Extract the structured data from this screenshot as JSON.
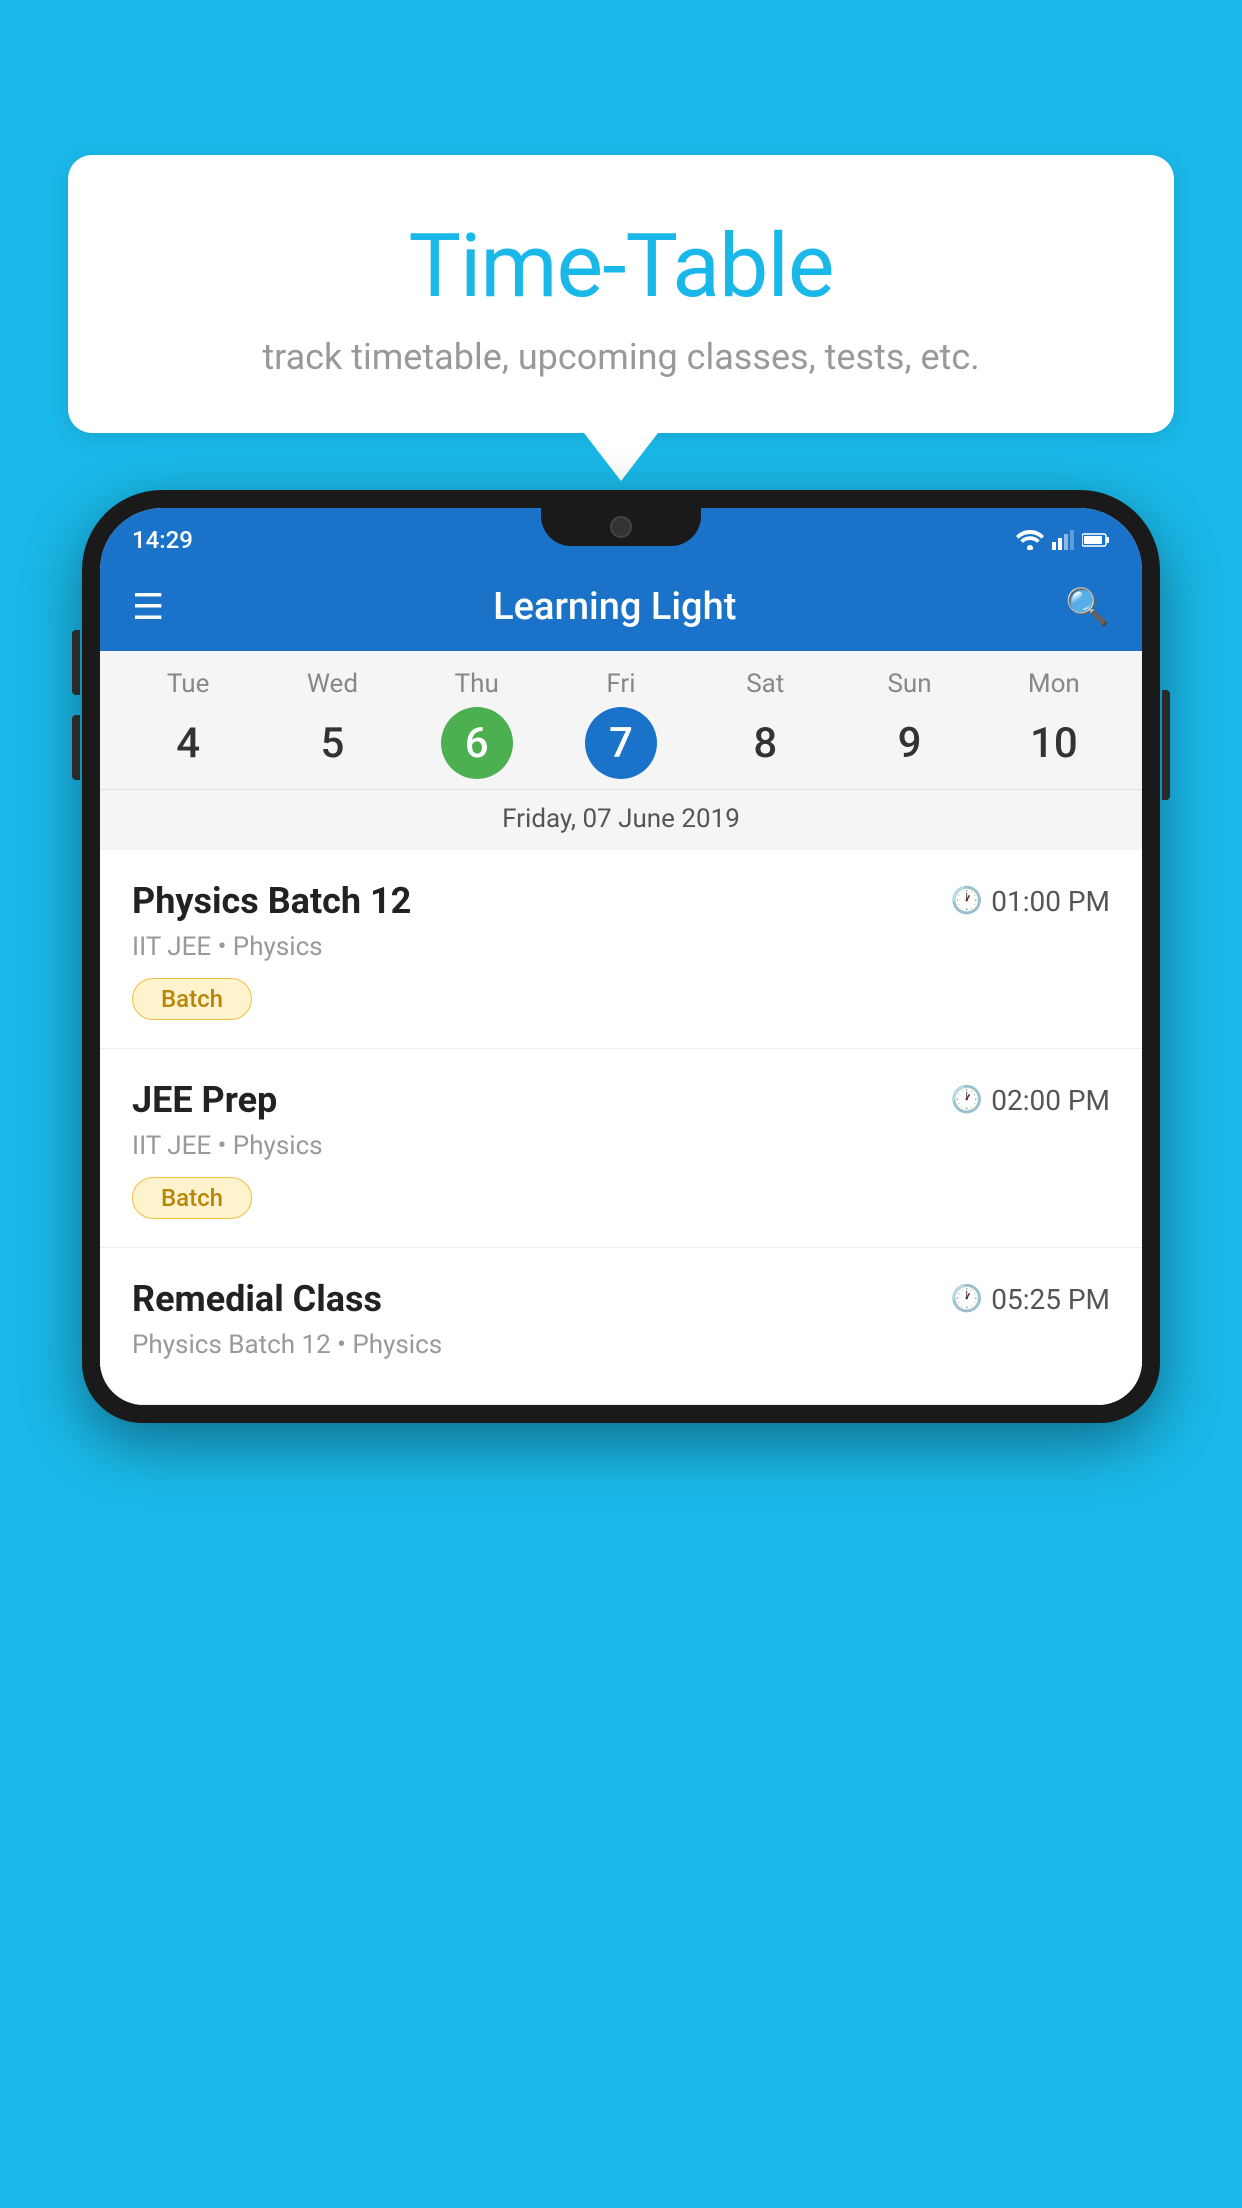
{
  "background_color": "#1ab8e8",
  "bubble": {
    "title": "Time-Table",
    "subtitle": "track timetable, upcoming classes, tests, etc."
  },
  "phone": {
    "status_bar": {
      "time": "14:29"
    },
    "app_bar": {
      "title": "Learning Light"
    },
    "calendar": {
      "days": [
        {
          "name": "Tue",
          "num": "4",
          "state": "normal"
        },
        {
          "name": "Wed",
          "num": "5",
          "state": "normal"
        },
        {
          "name": "Thu",
          "num": "6",
          "state": "today"
        },
        {
          "name": "Fri",
          "num": "7",
          "state": "selected"
        },
        {
          "name": "Sat",
          "num": "8",
          "state": "normal"
        },
        {
          "name": "Sun",
          "num": "9",
          "state": "normal"
        },
        {
          "name": "Mon",
          "num": "10",
          "state": "normal"
        }
      ],
      "selected_date_label": "Friday, 07 June 2019"
    },
    "schedule": [
      {
        "title": "Physics Batch 12",
        "time": "01:00 PM",
        "meta": "IIT JEE • Physics",
        "badge": "Batch"
      },
      {
        "title": "JEE Prep",
        "time": "02:00 PM",
        "meta": "IIT JEE • Physics",
        "badge": "Batch"
      },
      {
        "title": "Remedial Class",
        "time": "05:25 PM",
        "meta": "Physics Batch 12 • Physics",
        "badge": null
      }
    ]
  }
}
